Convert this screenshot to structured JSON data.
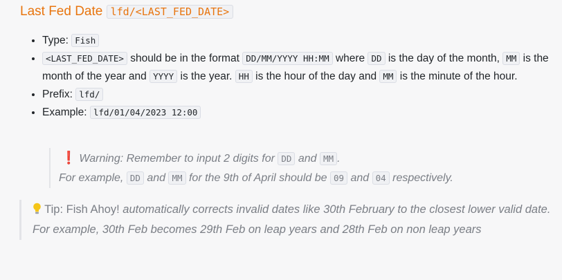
{
  "heading": {
    "text": "Last Fed Date",
    "code": "lfd/<LAST_FED_DATE>"
  },
  "items": {
    "type_label": "Type:",
    "type_value": "Fish",
    "format": {
      "param": "<LAST_FED_DATE>",
      "t1": " should be in the format ",
      "fmt": "DD/MM/YYYY HH:MM",
      "t2": " where ",
      "dd": "DD",
      "t3": " is the day of the month, ",
      "mm": "MM",
      "t4": " is the month of the year and ",
      "yyyy": "YYYY",
      "t5": " is the year. ",
      "hh": "HH",
      "t6": " is the hour of the day and ",
      "min": "MM",
      "t7": " is the minute of the hour."
    },
    "prefix_label": "Prefix:",
    "prefix_value": "lfd/",
    "example_label": "Example:",
    "example_value": "lfd/01/04/2023 12:00"
  },
  "warning": {
    "icon": "exclamation-icon",
    "t1": "Warning: Remember to input 2 digits for ",
    "dd": "DD",
    "t2": " and ",
    "mm": "MM",
    "t3": ".",
    "t4": "For example, ",
    "dd2": "DD",
    "t5": " and ",
    "mm2": "MM",
    "t6": " for the 9th of April should be ",
    "v09": "09",
    "t7": " and ",
    "v04": "04",
    "t8": " respectively."
  },
  "tip": {
    "icon": "lightbulb-icon",
    "label": "Tip:",
    "app": " Fish Ahoy!",
    "text": " automatically corrects invalid dates like 30th February to the closest lower valid date. For example, 30th Feb becomes 29th Feb on leap years and 28th Feb on non leap years"
  }
}
